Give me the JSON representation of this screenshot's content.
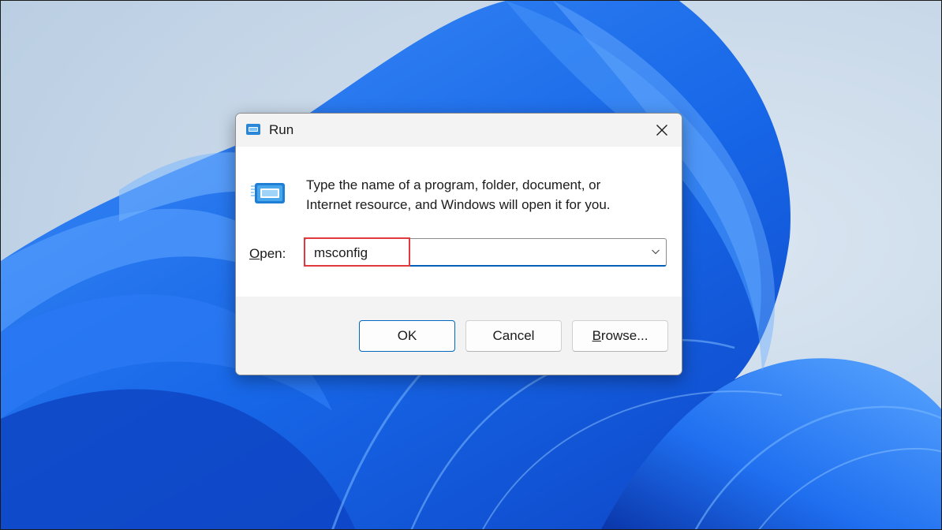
{
  "window": {
    "title": "Run",
    "close_icon": "close-icon",
    "title_icon": "run-icon"
  },
  "main": {
    "icon": "run-icon",
    "description_line1": "Type the name of a program, folder, document, or",
    "description_line2": "Internet resource, and Windows will open it for you.",
    "open_label_mnemonic": "O",
    "open_label_rest": "pen:",
    "open_value": "msconfig",
    "dropdown_icon": "chevron-down-icon"
  },
  "buttons": {
    "ok": "OK",
    "cancel": "Cancel",
    "browse_mnemonic": "B",
    "browse_rest": "rowse..."
  },
  "colors": {
    "accent": "#005fb8",
    "highlight": "#e0393e",
    "wallpaper_blue": "#1a6cf0",
    "wallpaper_bg": "#c9d9ea"
  }
}
